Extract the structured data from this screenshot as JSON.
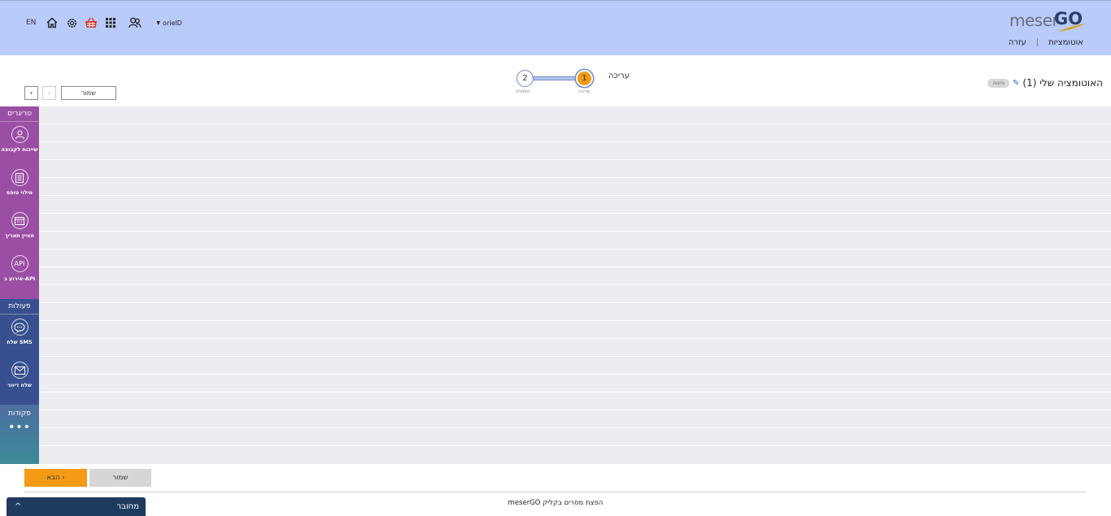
{
  "topbar": {
    "lang": "EN",
    "user": "orielD",
    "brand_left": "meser",
    "brand_right": "GO",
    "nav": [
      "אוטומציות",
      "עזרה"
    ],
    "bg_color": "#b8cbfa"
  },
  "page": {
    "title": "האוטומציה שלי (1)",
    "badge": "טיוטה"
  },
  "steps": {
    "current_label": "עריכה",
    "items": [
      {
        "number": "1",
        "label": "עריכה",
        "active": true
      },
      {
        "number": "2",
        "label": "הפעלה",
        "active": false
      }
    ]
  },
  "toolbar": {
    "save_label": "שמור",
    "prev_arrow": "‹",
    "next_arrow": "›"
  },
  "sidebar": {
    "triggers_header": "טריגרים",
    "triggers": [
      {
        "label": "שייכות לקבוצה",
        "icon": "group-icon"
      },
      {
        "label": "מילוי טופס",
        "icon": "form-icon"
      },
      {
        "label": "מציין תאריך",
        "icon": "calendar-icon"
      },
      {
        "label": "אירוע ב-API",
        "icon": "api-icon",
        "icon_text": "API"
      }
    ],
    "actions_header": "פעולות",
    "actions": [
      {
        "label": "שלח SMS",
        "icon": "sms-bubble-icon"
      },
      {
        "label": "שלח דיוור",
        "icon": "envelope-icon"
      }
    ],
    "commands_header": "פקודות",
    "commands_more": "•••",
    "colors": {
      "triggers": "#9b4fa4",
      "actions": "#38508f",
      "commands": "#3d8a9a"
    }
  },
  "bottom": {
    "next_label": "הבא ›",
    "save_label": "שמור",
    "footer": "meserGO הפצת מסרים בקליק",
    "status": "מחובר",
    "status_icon": "^"
  }
}
